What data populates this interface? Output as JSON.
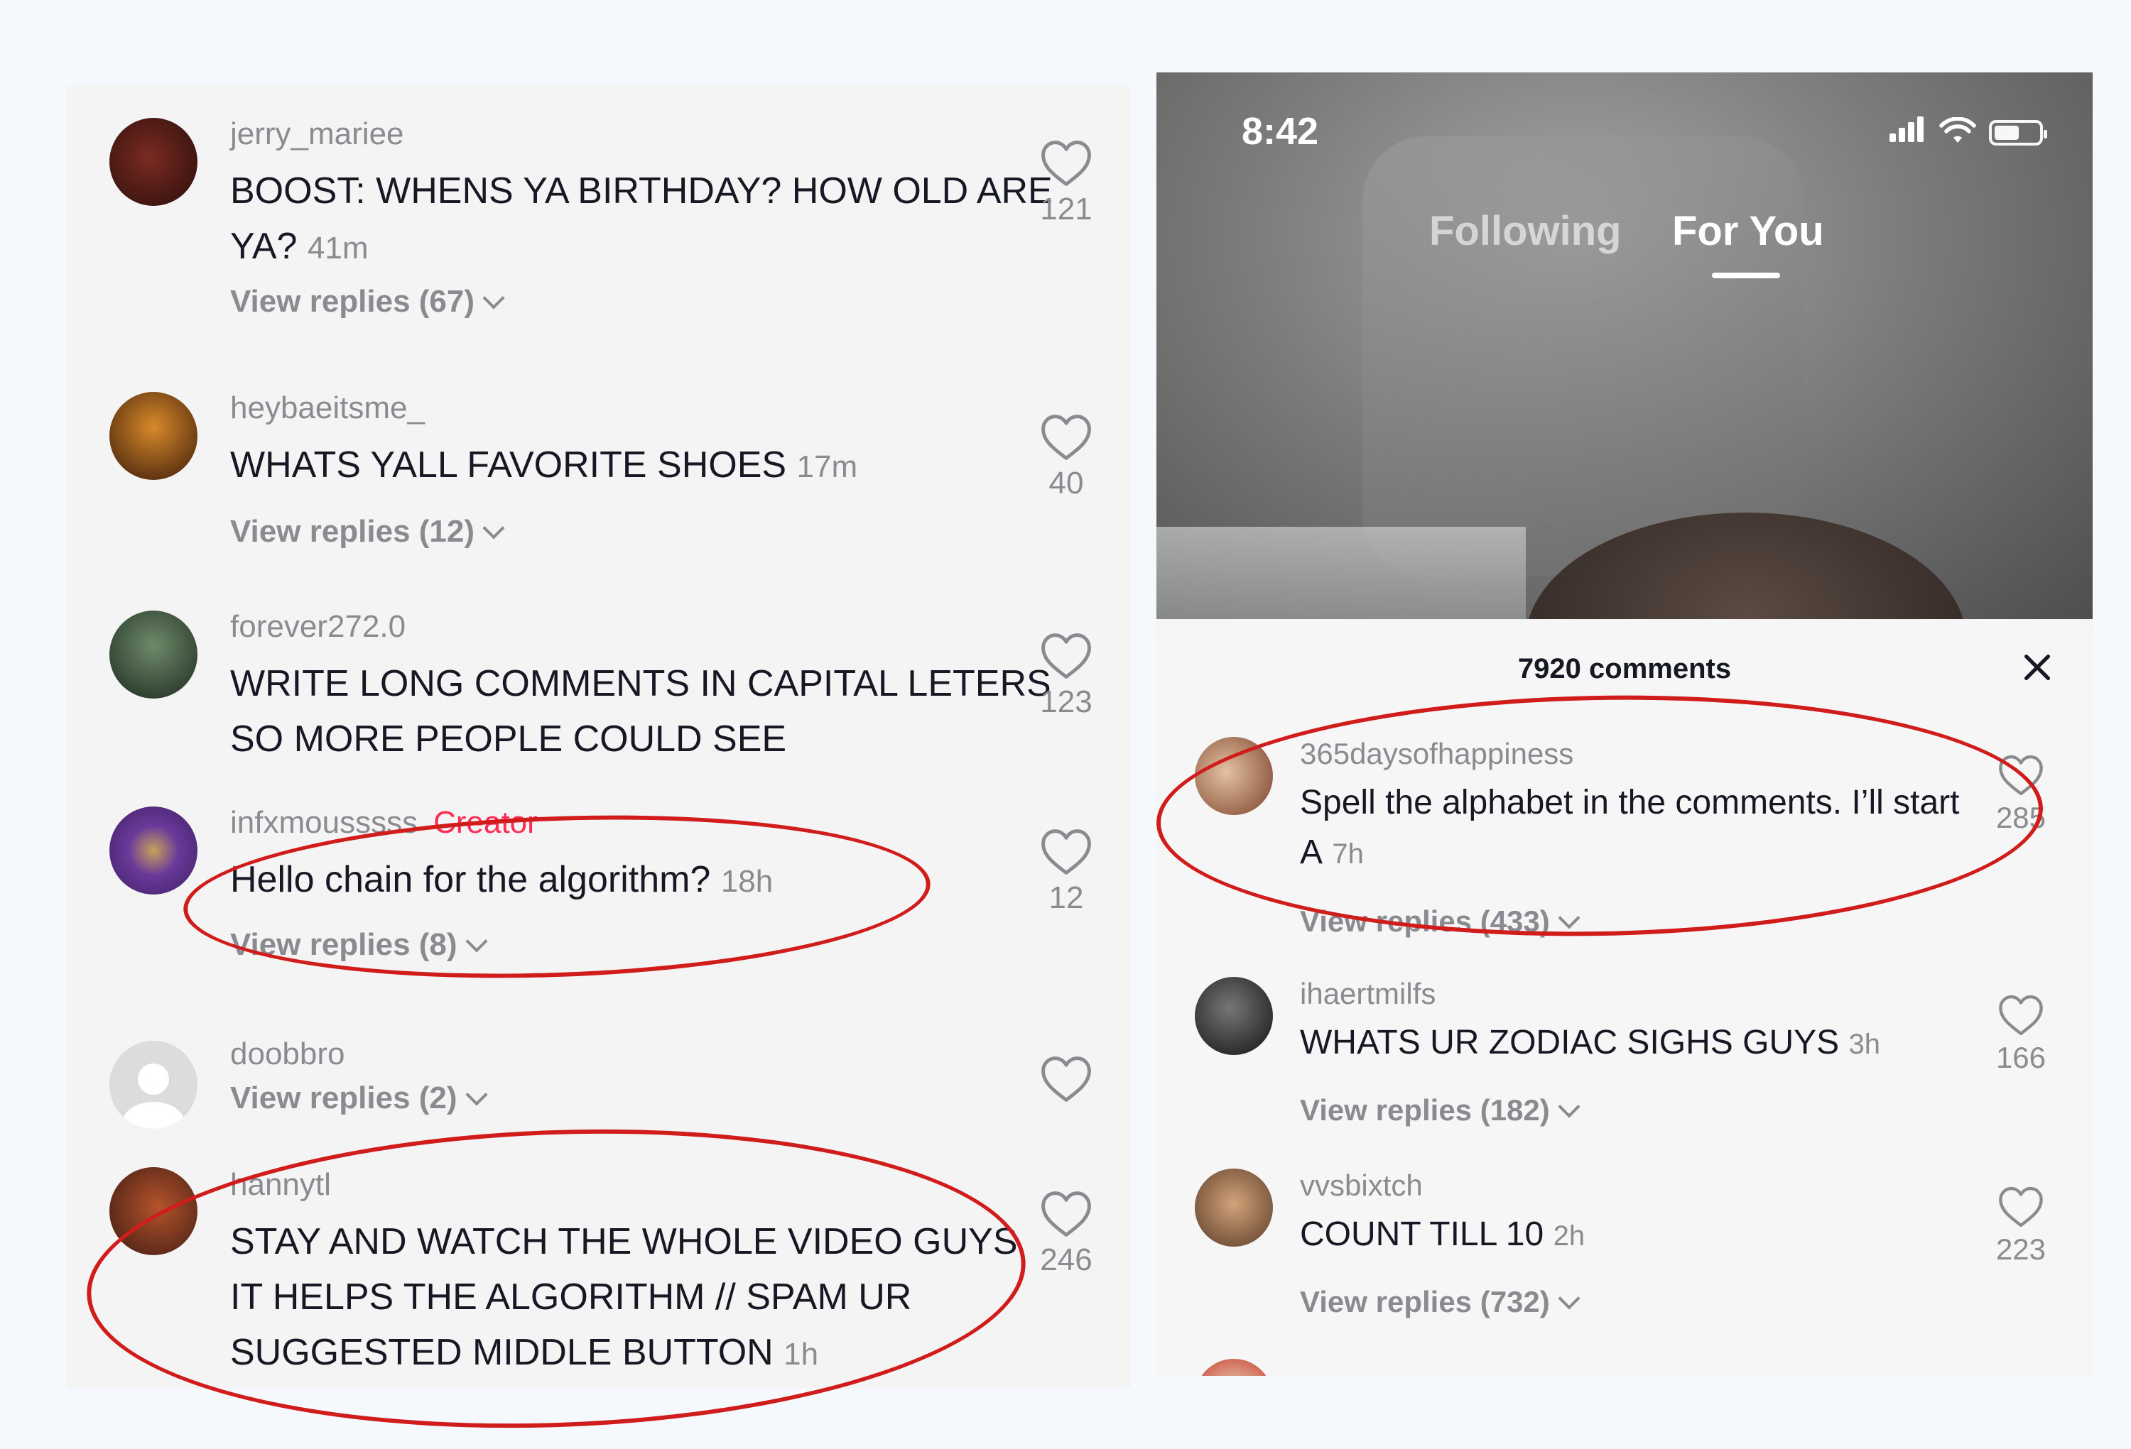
{
  "left_panel": {
    "comments": [
      {
        "username": "jerry_mariee",
        "text": "BOOST: WHENS YA BIRTHDAY? HOW OLD ARE YA?",
        "time": "41m",
        "replies": "View replies (67)",
        "likes": "121"
      },
      {
        "username": "heybaeitsme_",
        "text": "WHATS YALL FAVORITE SHOES",
        "time": "17m",
        "replies": "View replies (12)",
        "likes": "40"
      },
      {
        "username": "forever272.0",
        "text": "WRITE LONG COMMENTS IN CAPITAL LETERS SO MORE PEOPLE COULD SEE",
        "time": "",
        "replies": "",
        "likes": "123"
      },
      {
        "username": "infxmousssss",
        "badge": "Creator",
        "text": "Hello chain for the algorithm?",
        "time": "18h",
        "replies": "View replies (8)",
        "likes": "12"
      },
      {
        "username": "doobbro",
        "text": "",
        "time": "",
        "replies": "View replies (2)",
        "likes": ""
      },
      {
        "username": "hannytl",
        "text": "STAY AND WATCH THE WHOLE VIDEO GUYS IT HELPS THE ALGORITHM // SPAM UR SUGGESTED MIDDLE BUTTON",
        "time": "1h",
        "replies": "",
        "likes": "246"
      }
    ]
  },
  "right_panel": {
    "status_bar": {
      "time": "8:42"
    },
    "tabs": {
      "following": "Following",
      "for_you": "For You"
    },
    "sheet": {
      "title": "7920 comments",
      "comments": [
        {
          "username": "365daysofhappiness",
          "text": "Spell the alphabet in the comments. I’ll start A",
          "time": "7h",
          "replies": "View replies (433)",
          "likes": "285"
        },
        {
          "username": "ihaertmilfs",
          "text": "WHATS UR ZODIAC SIGHS GUYS",
          "time": "3h",
          "replies": "View replies (182)",
          "likes": "166"
        },
        {
          "username": "vvsbixtch",
          "text": "COUNT TILL 10",
          "time": "2h",
          "replies": "View replies (732)",
          "likes": "223"
        }
      ]
    }
  },
  "colors": {
    "annotation": "#d11c1c",
    "creator_badge": "#fe2c55",
    "muted_text": "#8a8b91"
  }
}
